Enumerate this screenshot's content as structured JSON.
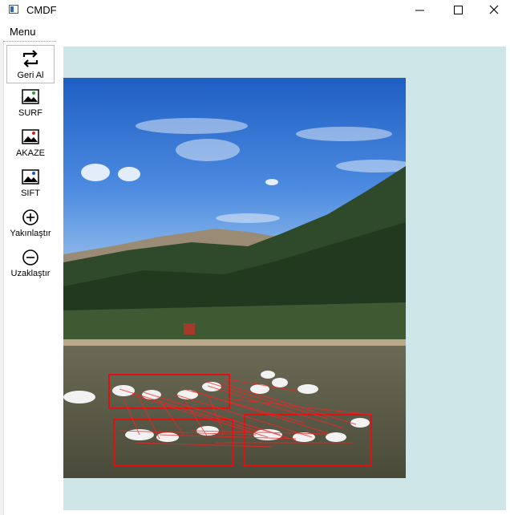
{
  "window": {
    "title": "CMDF"
  },
  "menu": {
    "label": "Menu"
  },
  "toolbar": {
    "items": [
      {
        "label": "Geri Al",
        "icon": "undo-rotate-icon",
        "selected": true
      },
      {
        "label": "SURF",
        "icon": "image-icon"
      },
      {
        "label": "AKAZE",
        "icon": "image-icon"
      },
      {
        "label": "SIFT",
        "icon": "image-icon"
      },
      {
        "label": "Yakınlaştır",
        "icon": "zoom-in-icon"
      },
      {
        "label": "Uzaklaştır",
        "icon": "zoom-out-icon"
      }
    ]
  },
  "viewer": {
    "background": "#cfe6e8",
    "image_subject": "lake with geese and forested hill, feature matches drawn in red",
    "match_color": "#e01010"
  }
}
